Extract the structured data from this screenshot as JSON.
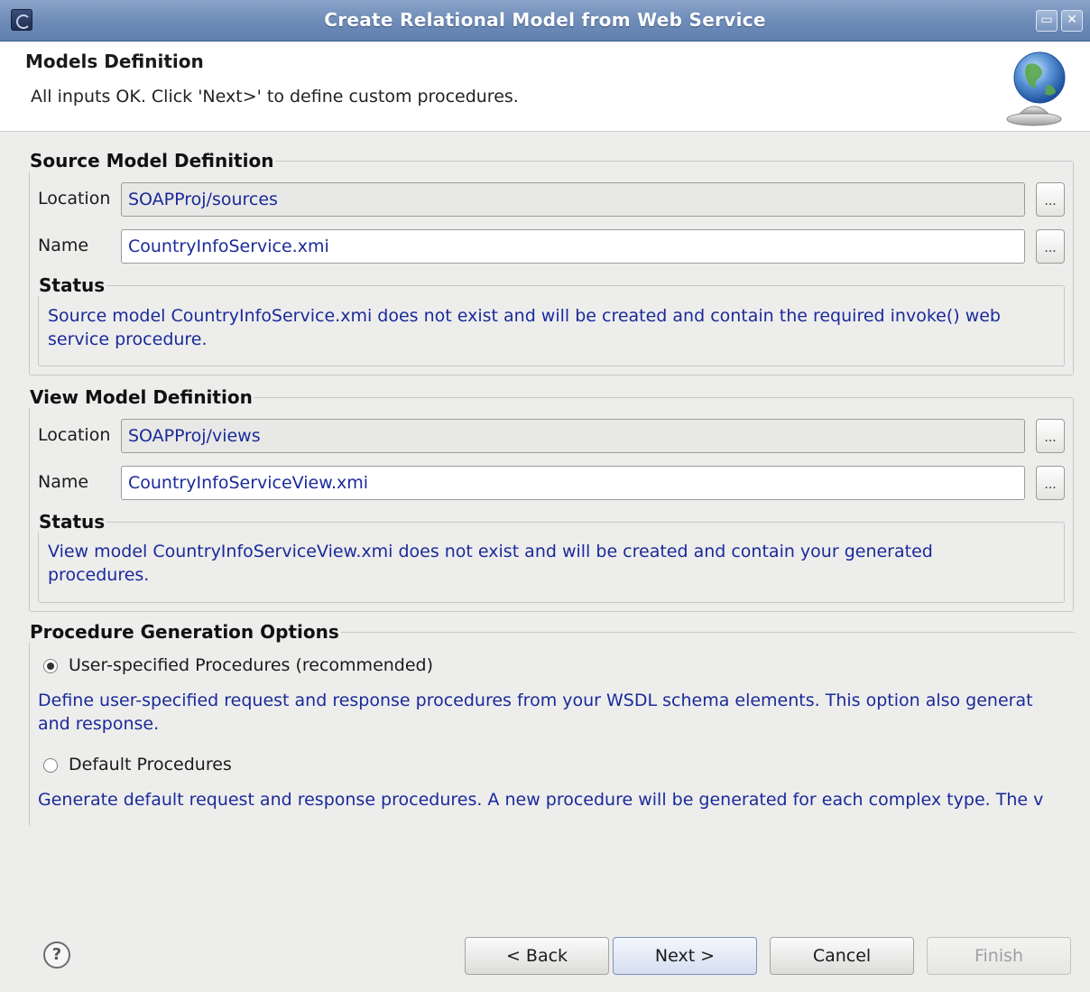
{
  "window": {
    "title": "Create Relational Model from Web Service"
  },
  "header": {
    "title": "Models Definition",
    "message": "All inputs OK. Click 'Next>' to define custom procedures."
  },
  "source_model": {
    "legend": "Source Model Definition",
    "location_label": "Location",
    "location_value": "SOAPProj/sources",
    "name_label": "Name",
    "name_value": "CountryInfoService.xmi",
    "browse_label": "...",
    "status_legend": "Status",
    "status_text": "Source model CountryInfoService.xmi does not exist and will be created and contain the required invoke() web service procedure."
  },
  "view_model": {
    "legend": "View Model Definition",
    "location_label": "Location",
    "location_value": "SOAPProj/views",
    "name_label": "Name",
    "name_value": "CountryInfoServiceView.xmi",
    "browse_label": "...",
    "status_legend": "Status",
    "status_text": "View model CountryInfoServiceView.xmi does not exist and will be created and contain your generated procedures."
  },
  "procedure_options": {
    "legend": "Procedure Generation Options",
    "option1_label": "User-specified Procedures (recommended)",
    "option1_selected": true,
    "option1_desc": "Define user-specified request and response procedures from your WSDL schema elements. This option also generat",
    "option1_desc_cont": "and response.",
    "option2_label": "Default Procedures",
    "option2_selected": false,
    "option2_desc": "Generate default request and response procedures. A new procedure will be generated for each complex type. The v"
  },
  "buttons": {
    "back": "< Back",
    "next": "Next >",
    "cancel": "Cancel",
    "finish": "Finish",
    "help": "?"
  },
  "colors": {
    "link_text": "#1a2a99",
    "titlebar": "#6f8db9"
  }
}
